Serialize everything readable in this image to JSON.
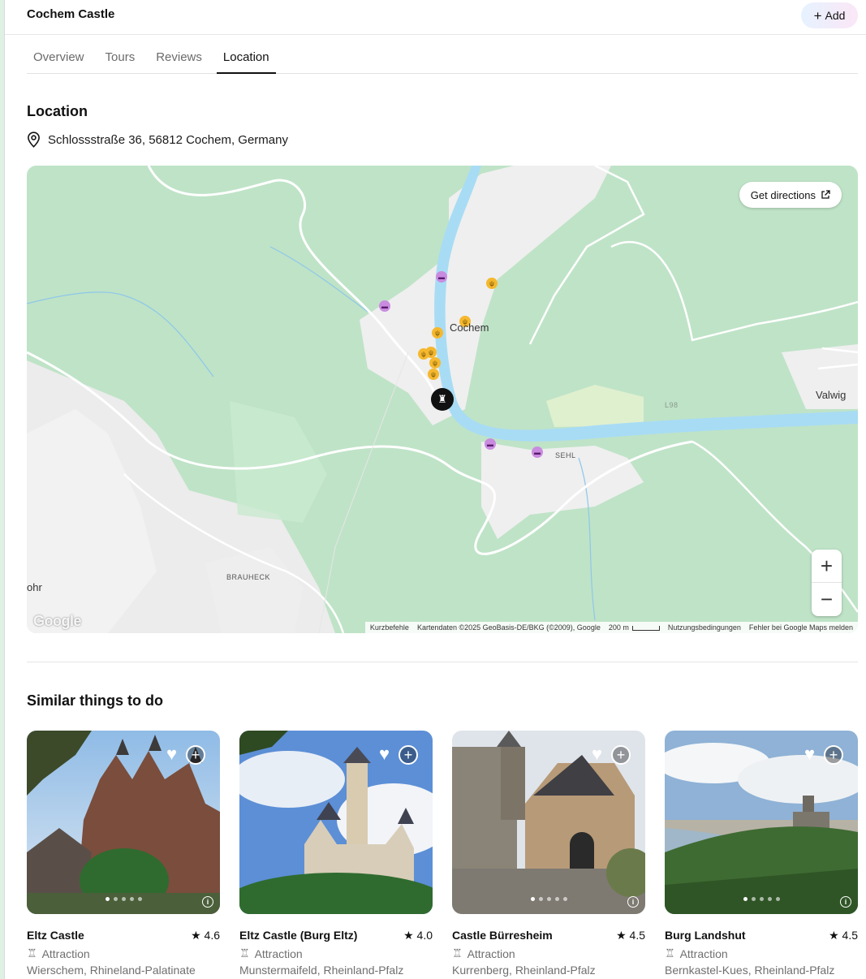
{
  "header": {
    "title": "Cochem Castle",
    "add_label": "Add"
  },
  "tabs": [
    {
      "label": "Overview"
    },
    {
      "label": "Tours"
    },
    {
      "label": "Reviews"
    },
    {
      "label": "Location"
    }
  ],
  "location": {
    "heading": "Location",
    "address": "Schlossstraße 36, 56812 Cochem, Germany"
  },
  "map": {
    "directions_label": "Get directions",
    "town_labels": {
      "cochem": "Cochem",
      "valwig": "Valwig",
      "sehl": "SEHL",
      "brauheck": "BRAUHECK",
      "ohr": "ohr",
      "road": "L98"
    },
    "logo": "Google",
    "footer": {
      "shortcuts": "Kurzbefehle",
      "copyright": "Kartendaten ©2025 GeoBasis-DE/BKG (©2009), Google",
      "scale": "200 m",
      "terms": "Nutzungsbedingungen",
      "report": "Fehler bei Google Maps melden"
    },
    "colors": {
      "river": "#a8dcf5",
      "forest": "#bfe3c7",
      "urban": "#f1f1f1",
      "food": "#f5b82e",
      "hotel": "#c98be0"
    }
  },
  "similar": {
    "heading": "Similar things to do",
    "cards": [
      {
        "name": "Eltz Castle",
        "rating": "4.6",
        "type": "Attraction",
        "location": "Wierschem, Rhineland-Palatinate"
      },
      {
        "name": "Eltz Castle (Burg Eltz)",
        "rating": "4.0",
        "type": "Attraction",
        "location": "Munstermaifeld, Rheinland-Pfalz"
      },
      {
        "name": "Castle Bürresheim",
        "rating": "4.5",
        "type": "Attraction",
        "location": "Kurrenberg, Rheinland-Pfalz"
      },
      {
        "name": "Burg Landshut",
        "rating": "4.5",
        "type": "Attraction",
        "location": "Bernkastel-Kues, Rheinland-Pfalz"
      }
    ]
  }
}
